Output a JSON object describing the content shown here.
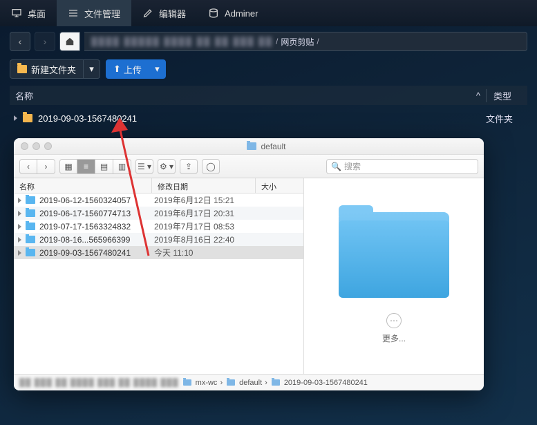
{
  "topnav": {
    "tabs": [
      {
        "label": "桌面",
        "icon": "monitor-icon"
      },
      {
        "label": "文件管理",
        "icon": "files-icon"
      },
      {
        "label": "编辑器",
        "icon": "edit-icon"
      },
      {
        "label": "Adminer",
        "icon": "db-icon"
      }
    ],
    "active_index": 1
  },
  "breadcrumb": {
    "visible_segment": "网页剪贴",
    "separator": "/"
  },
  "actions": {
    "new_folder_label": "新建文件夹",
    "upload_label": "上传",
    "caret": "▾",
    "upload_arrow": "⬆"
  },
  "dark_list": {
    "header_name": "名称",
    "header_type": "类型",
    "rows": [
      {
        "name": "2019-09-03-1567480241",
        "type": "文件夹"
      }
    ]
  },
  "finder": {
    "title": "default",
    "toolbar": {
      "back": "‹",
      "forward": "›",
      "views": [
        "▦",
        "≡",
        "▤",
        "▥"
      ],
      "active_view_index": 1,
      "sort": "☰ ▾",
      "gear": "⚙ ▾",
      "share": "⇪",
      "tag": "◯",
      "search_placeholder": "搜索",
      "search_icon": "🔍"
    },
    "headers": {
      "name": "名称",
      "modified": "修改日期",
      "size": "大小"
    },
    "rows": [
      {
        "name": "2019-06-12-1560324057",
        "date": "2019年6月12日 15:21"
      },
      {
        "name": "2019-06-17-1560774713",
        "date": "2019年6月17日 20:31"
      },
      {
        "name": "2019-07-17-1563324832",
        "date": "2019年7月17日 08:53"
      },
      {
        "name": "2019-08-16...565966399",
        "date": "2019年8月16日 22:40"
      },
      {
        "name": "2019-09-03-1567480241",
        "date": "今天 11:10"
      }
    ],
    "selected_index": 4,
    "more_label": "更多...",
    "path_segments": [
      "mx-wc",
      "default",
      "2019-09-03-1567480241"
    ],
    "path_sep": "›"
  }
}
